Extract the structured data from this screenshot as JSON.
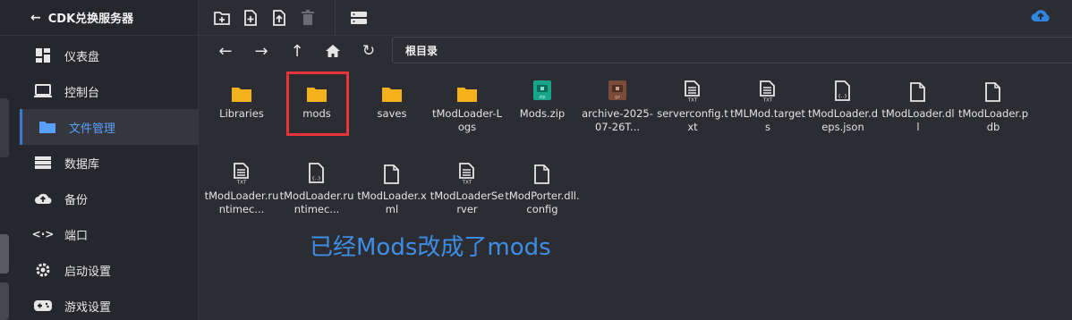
{
  "sidebar": {
    "title": "CDK兑换服务器",
    "items": [
      {
        "label": "仪表盘",
        "icon": "dashboard-icon"
      },
      {
        "label": "控制台",
        "icon": "monitor-icon"
      },
      {
        "label": "文件管理",
        "icon": "folder-icon"
      },
      {
        "label": "数据库",
        "icon": "database-icon"
      },
      {
        "label": "备份",
        "icon": "cloud-upload-icon"
      },
      {
        "label": "端口",
        "icon": "code-arrows-icon"
      },
      {
        "label": "启动设置",
        "icon": "gear-icon"
      },
      {
        "label": "游戏设置",
        "icon": "gamepad-icon"
      }
    ]
  },
  "path": {
    "label": "根目录"
  },
  "files": [
    {
      "name": "Libraries",
      "type": "folder"
    },
    {
      "name": "mods",
      "type": "folder"
    },
    {
      "name": "saves",
      "type": "folder"
    },
    {
      "name": "tModLoader-Logs",
      "type": "folder"
    },
    {
      "name": "Mods.zip",
      "type": "zip"
    },
    {
      "name": "archive-2025-07-26T...",
      "type": "gz"
    },
    {
      "name": "serverconfig.txt",
      "type": "txt"
    },
    {
      "name": "tMLMod.targets",
      "type": "txt"
    },
    {
      "name": "tModLoader.deps.json",
      "type": "json"
    },
    {
      "name": "tModLoader.dll",
      "type": "file"
    },
    {
      "name": "tModLoader.pdb",
      "type": "file"
    },
    {
      "name": "tModLoader.runtimec...",
      "type": "txt"
    },
    {
      "name": "tModLoader.runtimec...",
      "type": "json"
    },
    {
      "name": "tModLoader.xml",
      "type": "file"
    },
    {
      "name": "tModLoaderServer",
      "type": "txt"
    },
    {
      "name": "tModPorter.dll.config",
      "type": "file"
    }
  ],
  "annotation": "已经Mods改成了mods",
  "colors": {
    "accent": "#3a7bd5",
    "folder": "#f3b21a",
    "zip": "#17a589",
    "gz": "#7a4a3a",
    "highlight": "#e8343a"
  }
}
